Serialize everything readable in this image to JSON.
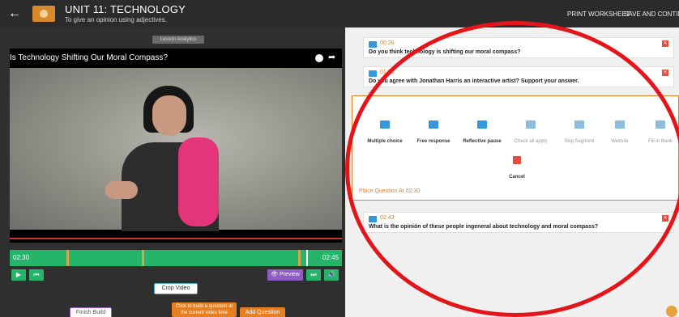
{
  "header": {
    "back_icon": "arrow-left-icon",
    "title": "UNIT 11: TECHNOLOGY",
    "subtitle": "To give an opinion using adjectives.",
    "print_label": "PRINT WORKSHEET",
    "save_label": "SAVE AND CONTINUE"
  },
  "editor": {
    "analytics_label": "Lesson Analytics",
    "video_title": "Is Technology Shifting Our Moral Compass?",
    "current_time": "02:30",
    "end_time": "02:45",
    "preview_label": "Preview",
    "crop_label": "Crop Video",
    "finish_label": "Finish Build",
    "build_hint": "Click to build a question at the current video time",
    "add_question_label": "Add Question"
  },
  "questions": [
    {
      "time": "00:26",
      "text": "Do you think technology is shifting our moral compass?"
    },
    {
      "time": "01:06",
      "text": "Do you agree with Jonathan Harris an interactive artist? Support your answer."
    },
    {
      "time": "02:43",
      "text": "What is the opinión of these people ingeneral about technology and moral compass?"
    }
  ],
  "picker": {
    "options": [
      {
        "label": "Multiple choice",
        "enabled": true
      },
      {
        "label": "Free response",
        "enabled": true
      },
      {
        "label": "Reflective pause",
        "enabled": true
      },
      {
        "label": "Check all apply",
        "enabled": false
      },
      {
        "label": "Skip Segment",
        "enabled": false
      },
      {
        "label": "Website",
        "enabled": false
      },
      {
        "label": "Fill in blank",
        "enabled": false
      }
    ],
    "cancel_label": "Cancel",
    "place_text": "Place Question At 02:30"
  },
  "colors": {
    "accent": "#e67e22",
    "green": "#26b36a",
    "annotation": "#e3151a"
  }
}
